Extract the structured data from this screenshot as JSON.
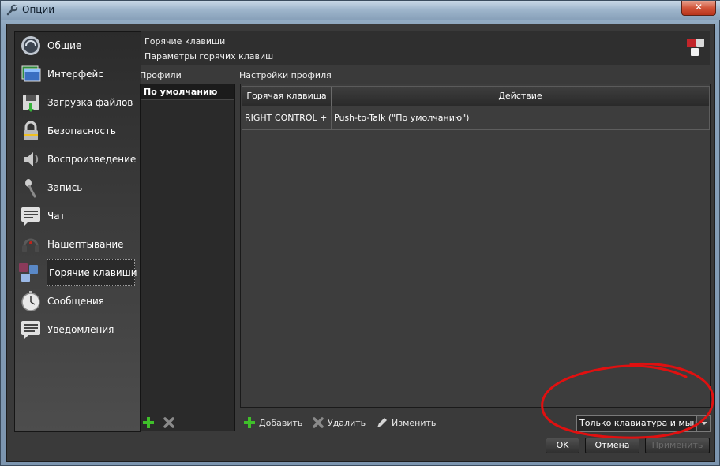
{
  "window": {
    "title": "Опции",
    "close_symbol": "✕"
  },
  "categories": [
    {
      "label": "Общие",
      "icon": "general-icon"
    },
    {
      "label": "Интерфейс",
      "icon": "interface-icon"
    },
    {
      "label": "Загрузка файлов",
      "icon": "file-download-icon"
    },
    {
      "label": "Безопасность",
      "icon": "lock-icon"
    },
    {
      "label": "Воспроизведение",
      "icon": "speaker-icon"
    },
    {
      "label": "Запись",
      "icon": "microphone-icon"
    },
    {
      "label": "Чат",
      "icon": "chat-icon"
    },
    {
      "label": "Нашептывание",
      "icon": "headset-icon"
    },
    {
      "label": "Горячие клавиши",
      "icon": "hotkeys-icon",
      "selected": true
    },
    {
      "label": "Сообщения",
      "icon": "stopwatch-icon"
    },
    {
      "label": "Уведомления",
      "icon": "notifications-icon"
    }
  ],
  "header": {
    "title": "Горячие клавиши",
    "subtitle": "Параметры горячих клавиш"
  },
  "profiles": {
    "label": "Профили",
    "items": [
      "По умолчанию"
    ]
  },
  "settings": {
    "label": "Настройки профиля",
    "columns": [
      "Горячая клавиша",
      "Действие"
    ],
    "rows": [
      {
        "hotkey": "RIGHT CONTROL +",
        "action": "Push-to-Talk (\"По умолчанию\")"
      }
    ]
  },
  "toolbar": {
    "add_label": "Добавить",
    "remove_label": "Удалить",
    "edit_label": "Изменить"
  },
  "device_filter": {
    "selected": "Только клавиатура и мышка"
  },
  "buttons": {
    "ok_label": "OK",
    "cancel_label": "Отмена",
    "apply_label": "Применить"
  },
  "colors": {
    "accent_green": "#3fbf2a",
    "annotation_red": "#e01010"
  }
}
